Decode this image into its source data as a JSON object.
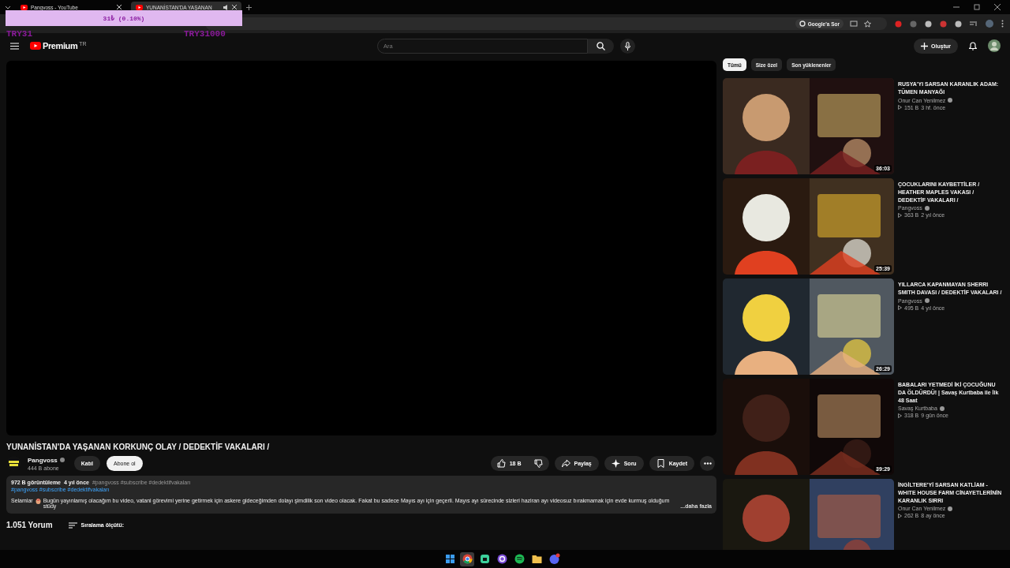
{
  "browser": {
    "tabs": [
      {
        "title": "Pangvoss - YouTube",
        "selected": false
      },
      {
        "title": "YUNANİSTAN'DA YAŞANAN",
        "selected": true
      }
    ],
    "ask_button": "Google'a Sor"
  },
  "stream_overlay": {
    "amount": "31₺ (0.10%)",
    "left_label": "TRY31",
    "right_label": "TRY31000"
  },
  "header": {
    "logo": "Premium",
    "region": "TR",
    "search_placeholder": "Ara",
    "create_button": "Oluştur"
  },
  "video": {
    "title": "YUNANİSTAN'DA YAŞANAN KORKUNÇ OLAY / DEDEKTİF VAKALARI /",
    "channel": "Pangvoss",
    "subscribers": "444 B abone",
    "join_button": "Katıl",
    "subscribe_button": "Abone ol",
    "likes": "18 B",
    "actions": [
      {
        "kind": "share",
        "label": "Paylaş"
      },
      {
        "kind": "ask",
        "label": "Soru"
      },
      {
        "kind": "save",
        "label": "Kaydet"
      }
    ]
  },
  "description": {
    "views": "972 B görüntüleme",
    "age": "4 yıl önce",
    "tags": "#pangvoss #subscribe #dedektifvakaları",
    "links": "#pangvoss #subscribe #dedektifvakaları",
    "greeting": "Selamlar",
    "text": "Bugün yayınlamış olacağım bu video, vatani görevimi yerine getirmek için askere gideceğimden dolayı şimdilik son video olacak. Fakat bu sadece Mayıs ayı için geçerli. Mayıs ayı sürecinde sizleri haziran ayı videosuz bırakmamak için evde kurmuş olduğum stüdy",
    "more": "...daha fazla"
  },
  "comments": {
    "count": "1.051 Yorum",
    "sort": "Sıralama ölçütü:"
  },
  "chips": [
    {
      "label": "Tümü",
      "selected": true
    },
    {
      "label": "Size özel",
      "selected": false
    },
    {
      "label": "Son yüklenenler",
      "selected": false
    }
  ],
  "recommendations": [
    {
      "title": "RUSYA'YI SARSAN KARANLIK ADAM: TÜMEN MANYAĞI",
      "channel": "Onur Can Yenilmez",
      "views": "151 B",
      "age": "3 hf. önce",
      "duration": "36:03"
    },
    {
      "title": "ÇOCUKLARINI KAYBETTİLER / HEATHER MAPLES VAKASI / DEDEKTİF VAKALARI /",
      "channel": "Pangvoss",
      "views": "363 B",
      "age": "2 yıl önce",
      "duration": "25:39"
    },
    {
      "title": "YILLARCA KAPANMAYAN SHERRI SMITH DAVASI / DEDEKTİF VAKALARI /",
      "channel": "Pangvoss",
      "views": "495 B",
      "age": "4 yıl önce",
      "duration": "26:29"
    },
    {
      "title": "BABALARI YETMEDİ İKİ ÇOCUĞUNU DA ÖLDÜRDÜ! | Savaş Kurtbaba ile İlk 48 Saat",
      "channel": "Savaş Kurtbaba",
      "views": "318 B",
      "age": "9 gün önce",
      "duration": "39:29"
    },
    {
      "title": "İNGİLTERE'Yİ SARSAN KATLİAM - WHITE HOUSE FARM CİNAYETLERİNİN KARANLIK SIRRI",
      "channel": "Onur Can Yenilmez",
      "views": "262 B",
      "age": "8 ay önce"
    }
  ],
  "taskbar": [
    {
      "kind": "start",
      "selected": false
    },
    {
      "kind": "browser",
      "selected": true
    },
    {
      "kind": "chat",
      "selected": false
    },
    {
      "kind": "ring",
      "selected": false
    },
    {
      "kind": "music",
      "selected": false
    },
    {
      "kind": "folder",
      "selected": false
    },
    {
      "kind": "discord",
      "selected": false
    }
  ]
}
